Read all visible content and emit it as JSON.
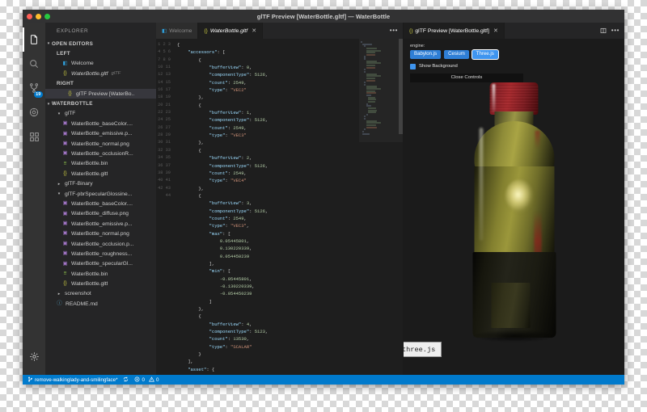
{
  "window": {
    "title": "glTF Preview [WaterBottle.gltf] — WaterBottle"
  },
  "activitybar": {
    "items": [
      {
        "name": "explorer",
        "icon": "files-icon"
      },
      {
        "name": "search",
        "icon": "search-icon"
      },
      {
        "name": "source-control",
        "icon": "source-control-icon",
        "badge": "19"
      },
      {
        "name": "debug",
        "icon": "debug-icon"
      },
      {
        "name": "extensions",
        "icon": "extensions-icon"
      }
    ],
    "settings_icon": "gear-icon"
  },
  "sidebar": {
    "title": "EXPLORER",
    "open_editors": {
      "label": "OPEN EDITORS",
      "groups": [
        {
          "label": "LEFT",
          "items": [
            {
              "label": "Welcome",
              "icon": "welcome-icon",
              "selected": false
            },
            {
              "label": "WaterBottle.gltf",
              "icon": "json-icon",
              "meta": "glTF",
              "selected": false
            }
          ]
        },
        {
          "label": "RIGHT",
          "items": [
            {
              "label": "glTF Preview [WaterBo..",
              "icon": "json-icon",
              "selected": true
            }
          ]
        }
      ]
    },
    "project": {
      "label": "WATERBOTTLE",
      "items": [
        {
          "label": "glTF",
          "depth": 1,
          "type": "folder",
          "expanded": true
        },
        {
          "label": "WaterBottle_baseColor....",
          "depth": 2,
          "type": "image"
        },
        {
          "label": "WaterBottle_emissive.p...",
          "depth": 2,
          "type": "image"
        },
        {
          "label": "WaterBottle_normal.png",
          "depth": 2,
          "type": "image"
        },
        {
          "label": "WaterBottle_occlusionR...",
          "depth": 2,
          "type": "image"
        },
        {
          "label": "WaterBottle.bin",
          "depth": 2,
          "type": "bin"
        },
        {
          "label": "WaterBottle.gltf",
          "depth": 2,
          "type": "json"
        },
        {
          "label": "glTF-Binary",
          "depth": 1,
          "type": "folder",
          "expanded": false
        },
        {
          "label": "glTF-pbrSpecularGlossine...",
          "depth": 1,
          "type": "folder",
          "expanded": true
        },
        {
          "label": "WaterBottle_baseColor....",
          "depth": 2,
          "type": "image"
        },
        {
          "label": "WaterBottle_diffuse.png",
          "depth": 2,
          "type": "image"
        },
        {
          "label": "WaterBottle_emissive.p...",
          "depth": 2,
          "type": "image"
        },
        {
          "label": "WaterBottle_normal.png",
          "depth": 2,
          "type": "image"
        },
        {
          "label": "WaterBottle_occlusion.p...",
          "depth": 2,
          "type": "image"
        },
        {
          "label": "WaterBottle_roughness...",
          "depth": 2,
          "type": "image"
        },
        {
          "label": "WaterBottle_specularGl...",
          "depth": 2,
          "type": "image"
        },
        {
          "label": "WaterBottle.bin",
          "depth": 2,
          "type": "bin"
        },
        {
          "label": "WaterBottle.gltf",
          "depth": 2,
          "type": "json"
        },
        {
          "label": "screenshot",
          "depth": 1,
          "type": "folder",
          "expanded": false
        },
        {
          "label": "README.md",
          "depth": 1,
          "type": "md"
        }
      ]
    }
  },
  "editor_left": {
    "tabs": [
      {
        "label": "Welcome",
        "icon": "welcome-icon",
        "active": false,
        "closable": false
      },
      {
        "label": "WaterBottle.gltf",
        "icon": "json-icon",
        "active": true,
        "closable": true
      }
    ],
    "more_actions": "more-actions-icon",
    "first_line": 1,
    "lines": [
      "{",
      "    \"accessors\": [",
      "        {",
      "            \"bufferView\": 0,",
      "            \"componentType\": 5126,",
      "            \"count\": 2549,",
      "            \"type\": \"VEC2\"",
      "        },",
      "        {",
      "            \"bufferView\": 1,",
      "            \"componentType\": 5126,",
      "            \"count\": 2549,",
      "            \"type\": \"VEC3\"",
      "        },",
      "        {",
      "            \"bufferView\": 2,",
      "            \"componentType\": 5126,",
      "            \"count\": 2549,",
      "            \"type\": \"VEC4\"",
      "        },",
      "        {",
      "            \"bufferView\": 3,",
      "            \"componentType\": 5126,",
      "            \"count\": 2549,",
      "            \"type\": \"VEC3\",",
      "            \"max\": [",
      "                0.05445801,",
      "                0.130220339,",
      "                0.054450239",
      "            ],",
      "            \"min\": [",
      "                -0.05445801,",
      "                -0.130220339,",
      "                -0.054450239",
      "            ]",
      "        },",
      "        {",
      "            \"bufferView\": 4,",
      "            \"componentType\": 5123,",
      "            \"count\": 13530,",
      "            \"type\": \"SCALAR\"",
      "        }",
      "    ],",
      "    \"asset\": {"
    ]
  },
  "editor_right": {
    "tab": {
      "label": "glTF Preview [WaterBottle.gltf]",
      "icon": "json-icon",
      "closable": true
    },
    "split_icon": "split-editor-icon",
    "more_actions": "more-actions-icon",
    "controls": {
      "engine_label": "engine:",
      "engines": [
        {
          "label": "Babylon.js",
          "selected": false
        },
        {
          "label": "Cesium",
          "selected": false
        },
        {
          "label": "Three.js",
          "selected": true
        }
      ],
      "show_background": {
        "label": "Show Background",
        "checked": true
      },
      "close_controls": "Close Controls"
    },
    "watermark": "three.js"
  },
  "statusbar": {
    "branch": {
      "icon": "branch-icon",
      "label": "remove-walkinglady-and-smilingface*"
    },
    "sync_icon": "sync-icon",
    "errors": {
      "icon": "error-icon",
      "count": "0"
    },
    "warnings": {
      "icon": "warning-icon",
      "count": "0"
    }
  },
  "colors": {
    "accent": "#007acc",
    "engine_blue": "#3f95ef",
    "titlebar": "#323233",
    "editor_bg": "#1e1e1e"
  }
}
